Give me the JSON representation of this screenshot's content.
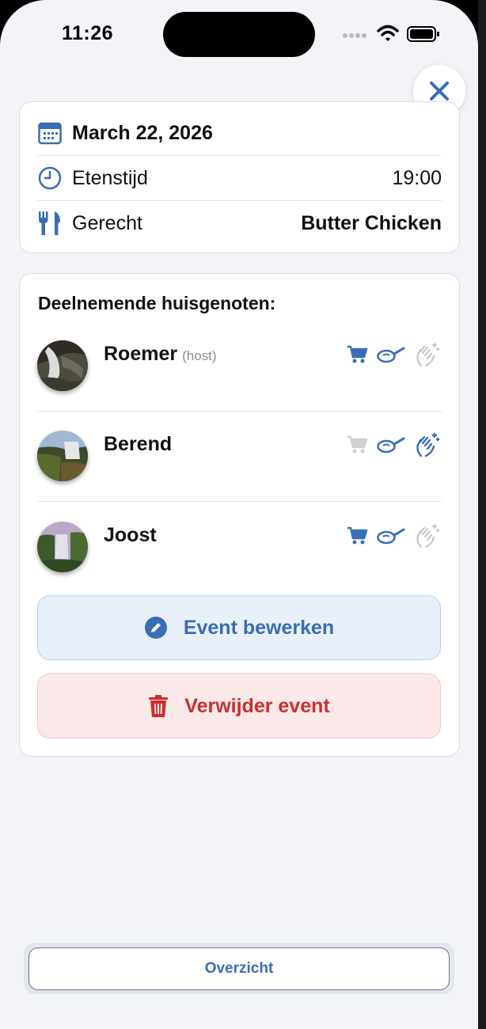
{
  "status_bar": {
    "time": "11:26"
  },
  "event": {
    "date": "March 22, 2026",
    "time_label": "Etenstijd",
    "time_value": "19:00",
    "dish_label": "Gerecht",
    "dish_value": "Butter Chicken"
  },
  "participants": {
    "title": "Deelnemende huisgenoten:",
    "members": [
      {
        "name": "Roemer",
        "tag": "(host)",
        "shopping": true,
        "cooking": true,
        "cleaning": false
      },
      {
        "name": "Berend",
        "tag": "",
        "shopping": false,
        "cooking": true,
        "cleaning": true
      },
      {
        "name": "Joost",
        "tag": "",
        "shopping": true,
        "cooking": true,
        "cleaning": false
      }
    ]
  },
  "actions": {
    "edit_label": "Event bewerken",
    "delete_label": "Verwijder event"
  },
  "footer": {
    "overview_label": "Overzicht"
  },
  "colors": {
    "accent": "#3a6db6",
    "danger": "#c9302c",
    "inactive": "#c8c8cc"
  }
}
